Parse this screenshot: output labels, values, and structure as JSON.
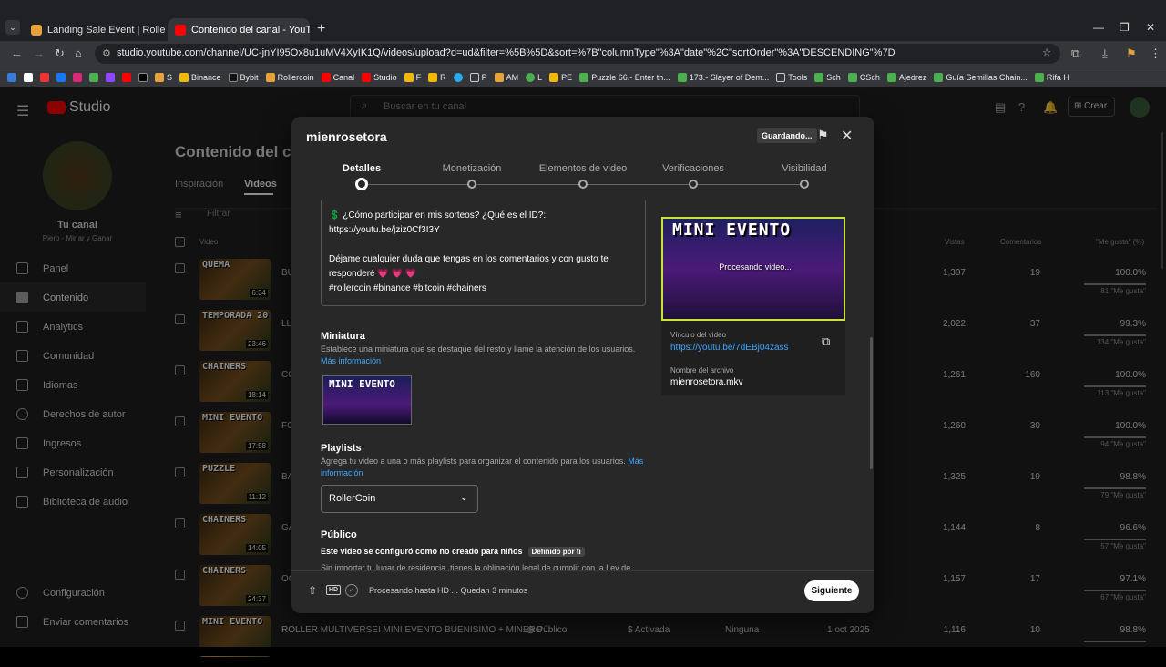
{
  "browser": {
    "tabs": [
      {
        "label": "Landing Sale Event | RollerCoin",
        "fav": "#e6a23c"
      },
      {
        "label": "Contenido del canal - YouTube",
        "fav": "#ff0000"
      }
    ],
    "url": "studio.youtube.com/channel/UC-jnYI95Ox8u1uMV4XyIK1Q/videos/upload?d=ud&filter=%5B%5D&sort=%7B\"columnType\"%3A\"date\"%2C\"sortOrder\"%3A\"DESCENDING\"%7D",
    "bookmarks": [
      "S",
      "Binance",
      "Bybit",
      "Rollercoin",
      "Canal",
      "Studio",
      "F",
      "R",
      "P",
      "AM",
      "L",
      "PE",
      "Puzzle 66.- Enter th...",
      "173.- Slayer of Dem...",
      "Tools",
      "Sch",
      "CSch",
      "Ajedrez",
      "Guía Semillas Chain...",
      "Rifa H"
    ]
  },
  "studio": {
    "logo": "Studio",
    "search_placeholder": "Buscar en tu canal",
    "create_label": "Crear",
    "channel_name": "Tu canal",
    "channel_sub": "Piero - Minar y Ganar",
    "page_title": "Contenido del canal",
    "tabs": [
      "Inspiración",
      "Videos"
    ],
    "filter_placeholder": "Filtrar",
    "nav": [
      "Panel",
      "Contenido",
      "Analytics",
      "Comunidad",
      "Idiomas",
      "Derechos de autor",
      "Ingresos",
      "Personalización",
      "Biblioteca de audio"
    ],
    "nav_bottom": [
      "Configuración",
      "Enviar comentarios"
    ],
    "columns": {
      "video": "Video",
      "views": "Vistas",
      "comments": "Comentarios",
      "likes": "\"Me gusta\" (%)"
    },
    "rows": [
      {
        "title": "QUEMA",
        "dur": "6:34",
        "prefix": "BU",
        "views": "1,307",
        "comments": "19",
        "likes_pct": "100.0%",
        "likes": "81 \"Me gusta\""
      },
      {
        "title": "TEMPORADA 20",
        "dur": "23:46",
        "prefix": "LL",
        "views": "2,022",
        "comments": "37",
        "likes_pct": "99.3%",
        "likes": "134 \"Me gusta\""
      },
      {
        "title": "CHAINERS",
        "dur": "18:14",
        "prefix": "CO",
        "views": "1,261",
        "comments": "160",
        "likes_pct": "100.0%",
        "likes": "113 \"Me gusta\""
      },
      {
        "title": "MINI EVENTO",
        "dur": "17:58",
        "prefix": "FO",
        "views": "1,260",
        "comments": "30",
        "likes_pct": "100.0%",
        "likes": "94 \"Me gusta\""
      },
      {
        "title": "PUZZLE",
        "dur": "11:12",
        "prefix": "BA",
        "views": "1,325",
        "comments": "19",
        "likes_pct": "98.8%",
        "likes": "79 \"Me gusta\""
      },
      {
        "title": "CHAINERS",
        "dur": "14:05",
        "prefix": "GA",
        "views": "1,144",
        "comments": "8",
        "likes_pct": "96.6%",
        "likes": "57 \"Me gusta\""
      },
      {
        "title": "CHAINERS",
        "dur": "24:37",
        "prefix": "OC",
        "views": "1,157",
        "comments": "17",
        "likes_pct": "97.1%",
        "likes": "67 \"Me gusta\""
      },
      {
        "title": "MINI EVENTO",
        "dur": "",
        "prefix": "ROLLER MULTIVERSE! MINI EVENTO BUENISIMO + MINERO ...",
        "visibility": "Público",
        "monet": "Activada",
        "restr": "Ninguna",
        "date": "1 oct 2025",
        "views": "1,116",
        "comments": "10",
        "likes_pct": "98.8%",
        "likes": ""
      }
    ]
  },
  "modal": {
    "title": "mienrosetora",
    "saving": "Guardando...",
    "steps": [
      "Detalles",
      "Monetización",
      "Elementos de video",
      "Verificaciones",
      "Visibilidad"
    ],
    "desc_lines": [
      "💲 ¿Cómo participar en mis sorteos? ¿Qué es el ID?:",
      "https://youtu.be/jziz0Cf3I3Y",
      "",
      "Déjame cualquier duda que tengas en los comentarios y con gusto te",
      "responderé 💗 💗 💗",
      "#rollercoin #binance #bitcoin #chainers"
    ],
    "thumb_heading": "Miniatura",
    "thumb_desc": "Establece una miniatura que se destaque del resto y llame la atención de los usuarios.",
    "more_info": "Más información",
    "mini_text": "MINI EVENTO",
    "playlists_heading": "Playlists",
    "playlists_desc": "Agrega tu video a una o más playlists para organizar el contenido para los usuarios.",
    "playlist_value": "RollerCoin",
    "audience_heading": "Público",
    "audience_text": "Este video se configuró como no creado para niños",
    "audience_badge": "Definido por ti",
    "audience_legal": "Sin importar tu lugar de residencia, tienes la obligación legal de cumplir con la Ley de",
    "preview_title": "MINI EVENTO",
    "processing": "Procesando video...",
    "link_label": "Vínculo del video",
    "link_value": "https://youtu.be/7dEBj04zass",
    "file_label": "Nombre del archivo",
    "file_value": "mienrosetora.mkv",
    "footer_status": "Procesando hasta HD ... Quedan 3 minutos",
    "hd": "HD",
    "next": "Siguiente"
  }
}
